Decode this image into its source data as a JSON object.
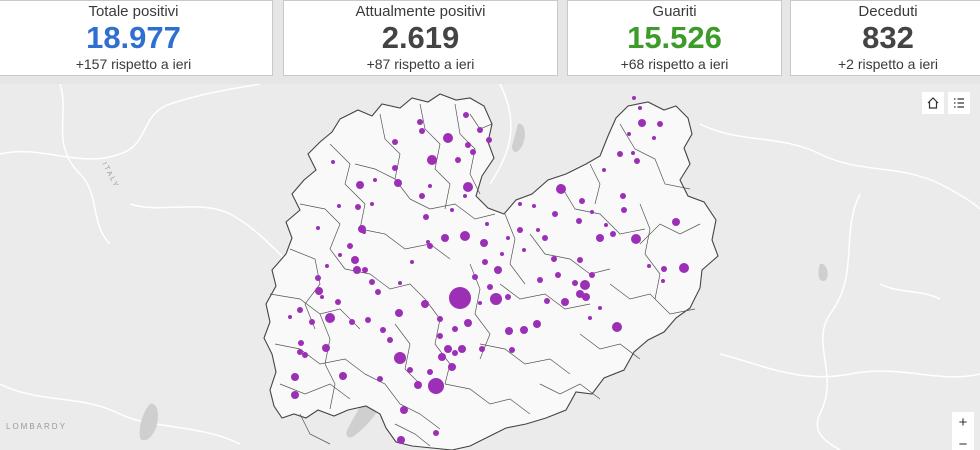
{
  "cards": {
    "totale": {
      "label": "Totale positivi",
      "value": "18.977",
      "delta": "+157 rispetto a ieri",
      "color": "#2f6fd0"
    },
    "attuali": {
      "label": "Attualmente positivi",
      "value": "2.619",
      "delta": "+87 rispetto a ieri",
      "color": "#444444"
    },
    "guariti": {
      "label": "Guariti",
      "value": "15.526",
      "delta": "+68 rispetto a ieri",
      "color": "#3d9b2a"
    },
    "deceduti": {
      "label": "Deceduti",
      "value": "832",
      "delta": "+2 rispetto a ieri",
      "color": "#444444"
    }
  },
  "map": {
    "labels": {
      "lombardy": "LOMBARDY",
      "italy": "ITALY"
    },
    "zoom_in": "+",
    "zoom_out": "−",
    "icons": {
      "home": "home-icon",
      "legend": "list-icon"
    },
    "point_color": "#9b2fb5"
  }
}
